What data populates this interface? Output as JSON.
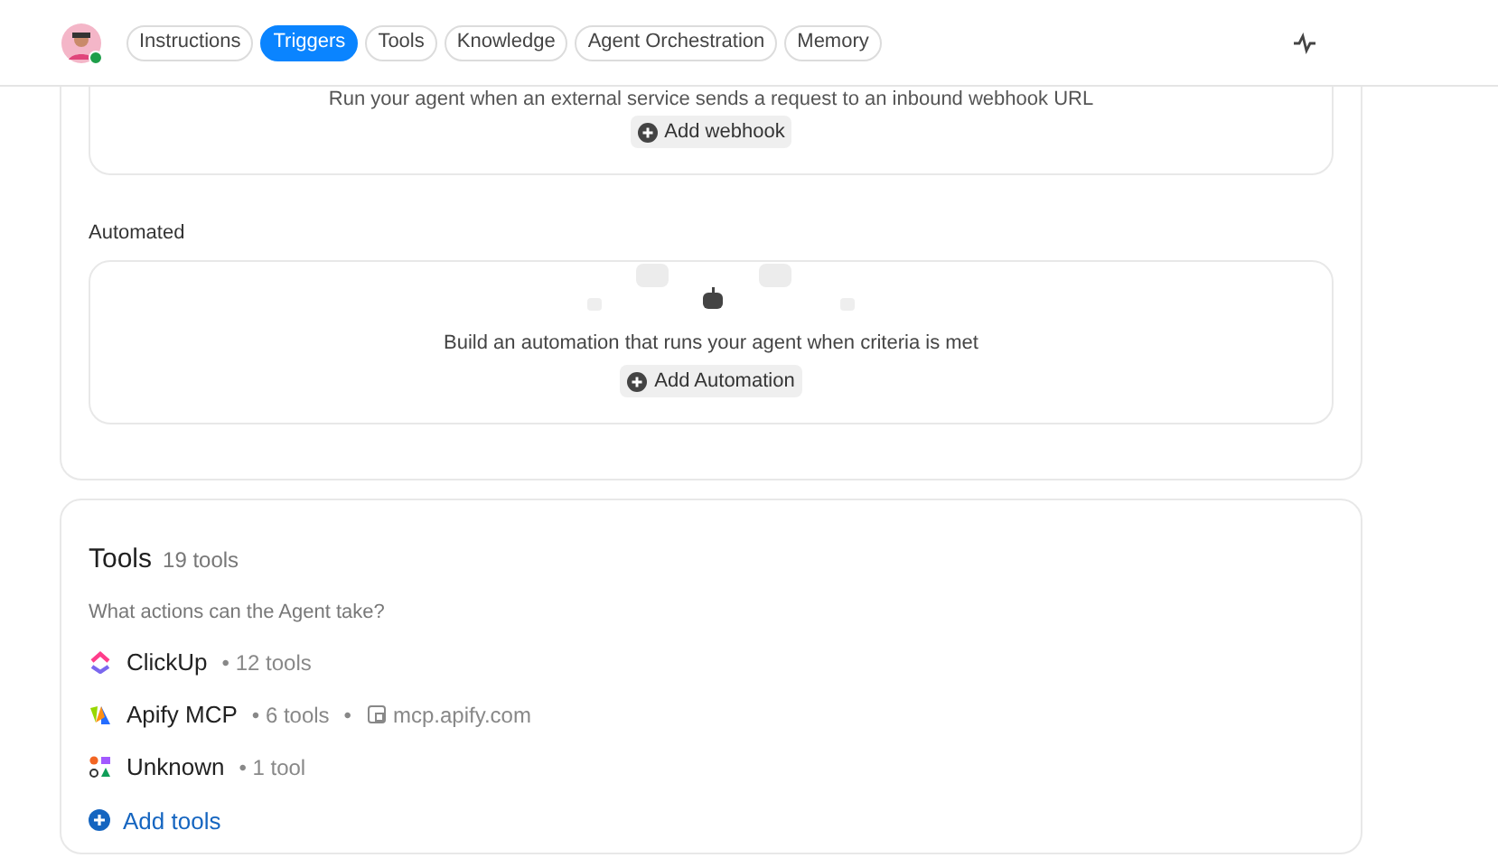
{
  "header": {
    "avatar": {
      "online": true
    },
    "tabs": [
      {
        "label": "Instructions",
        "selected": false
      },
      {
        "label": "Triggers",
        "selected": true
      },
      {
        "label": "Tools",
        "selected": false
      },
      {
        "label": "Knowledge",
        "selected": false
      },
      {
        "label": "Agent Orchestration",
        "selected": false
      },
      {
        "label": "Memory",
        "selected": false
      }
    ]
  },
  "triggers": {
    "webhook": {
      "description": "Run your agent when an external service sends a request to an inbound webhook URL",
      "button": "Add webhook"
    },
    "automated": {
      "label": "Automated",
      "description": "Build an automation that runs your agent when criteria is met",
      "button": "Add Automation"
    }
  },
  "tools": {
    "title": "Tools",
    "count": "19 tools",
    "subtitle": "What actions can the Agent take?",
    "items": [
      {
        "kind": "clickup",
        "name": "ClickUp",
        "count": "• 12 tools"
      },
      {
        "kind": "apify",
        "name": "Apify MCP",
        "count": "• 6 tools",
        "separator": "•",
        "url": "mcp.apify.com"
      },
      {
        "kind": "multi",
        "name": "Unknown",
        "count": "• 1 tool"
      }
    ],
    "add": "Add tools"
  }
}
